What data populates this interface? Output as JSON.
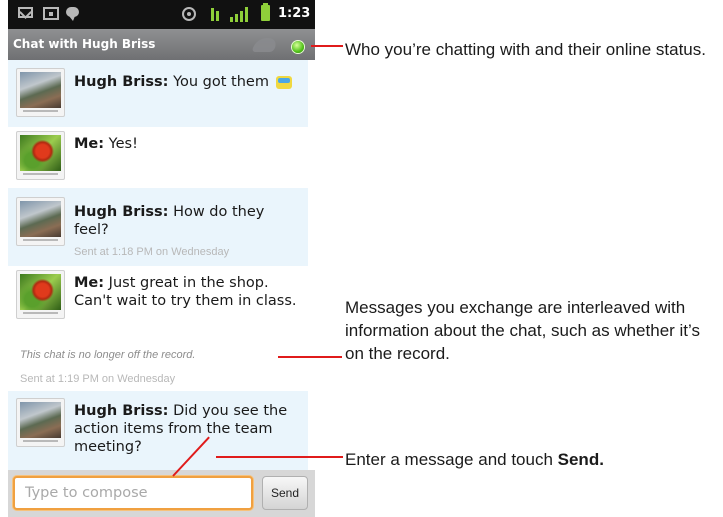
{
  "status_bar": {
    "time": "1:23"
  },
  "chat_header": {
    "title": "Chat with Hugh Briss",
    "online_status_color": "#52c31a"
  },
  "messages": [
    {
      "sender": "Hugh Briss:",
      "text": "You got them",
      "emoji": "smiley-icon"
    },
    {
      "sender": "Me:",
      "text": "Yes!"
    },
    {
      "sender": "Hugh Briss:",
      "text": "How do they feel?",
      "meta": "Sent at 1:18 PM on Wednesday"
    },
    {
      "sender": "Me:",
      "text": "Just great in the shop. Can't wait to try them in class."
    },
    {
      "sender": "Hugh Briss:",
      "text": "Did you see the action items from the team meeting?"
    }
  ],
  "system_messages": {
    "record_notice": "This chat is no longer off the record.",
    "sent_info": "Sent at 1:19 PM on Wednesday"
  },
  "composer": {
    "placeholder": "Type to compose",
    "send_label": "Send"
  },
  "annotations": {
    "status": "Who you’re chatting with and their online status.",
    "messages": "Messages you exchange are interleaved with information about the chat, such as whether it’s on the record.",
    "compose_prefix": "Enter a message and touch ",
    "compose_bold": "Send."
  }
}
